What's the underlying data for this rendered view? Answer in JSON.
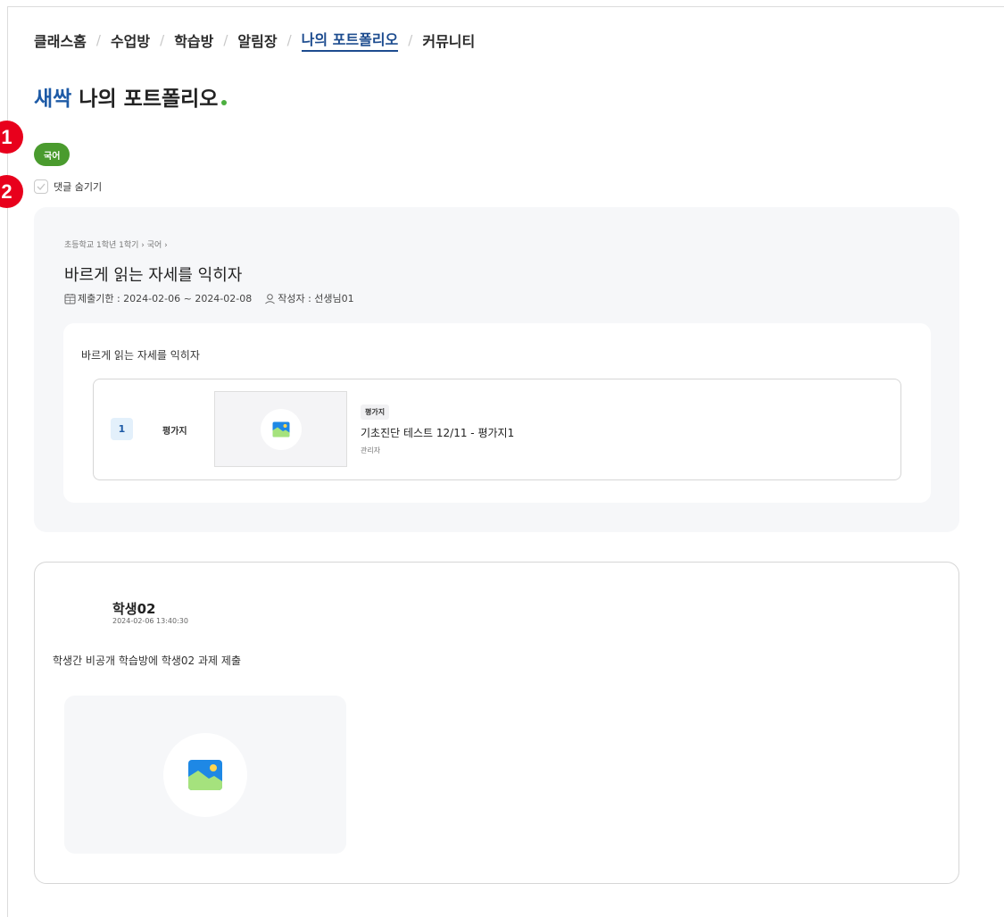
{
  "breadcrumb": {
    "items": [
      "클래스홈",
      "수업방",
      "학습방",
      "알림장",
      "나의 포트폴리오",
      "커뮤니티"
    ],
    "separator": "/",
    "active_index": 4
  },
  "page": {
    "title_accent": "새싹",
    "title_rest": "나의 포트폴리오"
  },
  "markers": [
    "1",
    "2"
  ],
  "filter": {
    "subject_chip": "국어",
    "hide_comments_label": "댓글 숨기기",
    "hide_comments_checked": false
  },
  "assignment": {
    "path": "초등학교 1학년 1학기 › 국어 ›",
    "title": "바르게 읽는 자세를 익히자",
    "deadline": "제출기한 : 2024-02-06 ~ 2024-02-08",
    "author": "작성자 : 선생님01",
    "content_title": "바르게 읽는 자세를 익히자",
    "item": {
      "number": "1",
      "type": "평가지",
      "tag": "평가지",
      "title": "기초진단 테스트 12/11 - 평가지1",
      "author": "관리자"
    }
  },
  "comment": {
    "student_name": "학생02",
    "timestamp": "2024-02-06 13:40:30",
    "text": "학생간 비공개 학습방에 학생02 과제 제출"
  },
  "icons": {
    "image_placeholder": "image-icon",
    "calendar": "calendar-icon",
    "person": "person-icon",
    "check": "check-icon"
  },
  "colors": {
    "accent_blue": "#1d5aa6",
    "subject_green": "#4a9b2e",
    "marker_red": "#e8001c",
    "panel_gray": "#f6f7f9"
  }
}
